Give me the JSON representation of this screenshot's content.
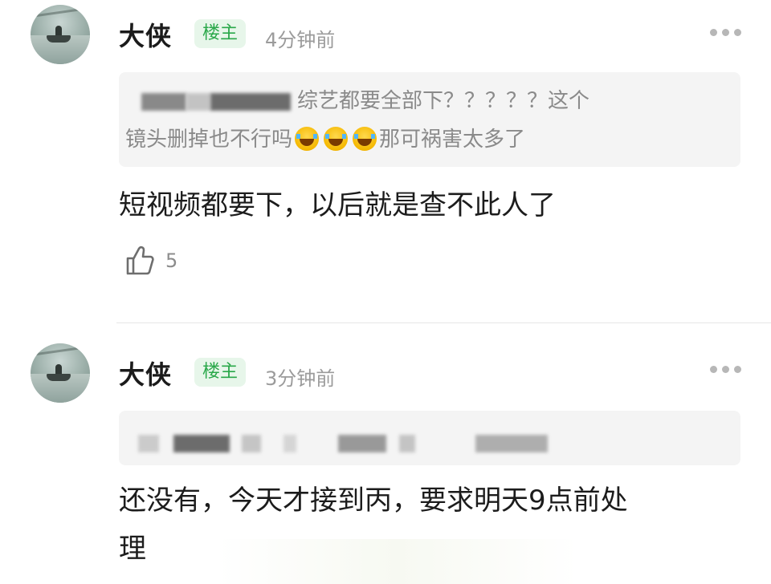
{
  "comments": [
    {
      "username": "大侠",
      "badge": "楼主",
      "time": "4分钟前",
      "quote_line1": "综艺都要全部下？？？？？这个",
      "quote_line2_a": "镜头删掉也不行吗",
      "quote_line2_b": "那可祸害太多了",
      "body": "短视频都要下，以后就是查不此人了",
      "likes": "5"
    },
    {
      "username": "大侠",
      "badge": "楼主",
      "time": "3分钟前",
      "body_line1": "还没有，今天才接到丙，要求明天9点前处",
      "body_line2": "理"
    }
  ],
  "icons": {
    "more": "more-dots-icon",
    "like": "thumbs-up-icon",
    "emoji": "laughing-tears-emoji"
  },
  "colors": {
    "badge_bg": "#e7f6ea",
    "badge_text": "#2aa84a",
    "quote_bg": "#f4f4f4"
  }
}
